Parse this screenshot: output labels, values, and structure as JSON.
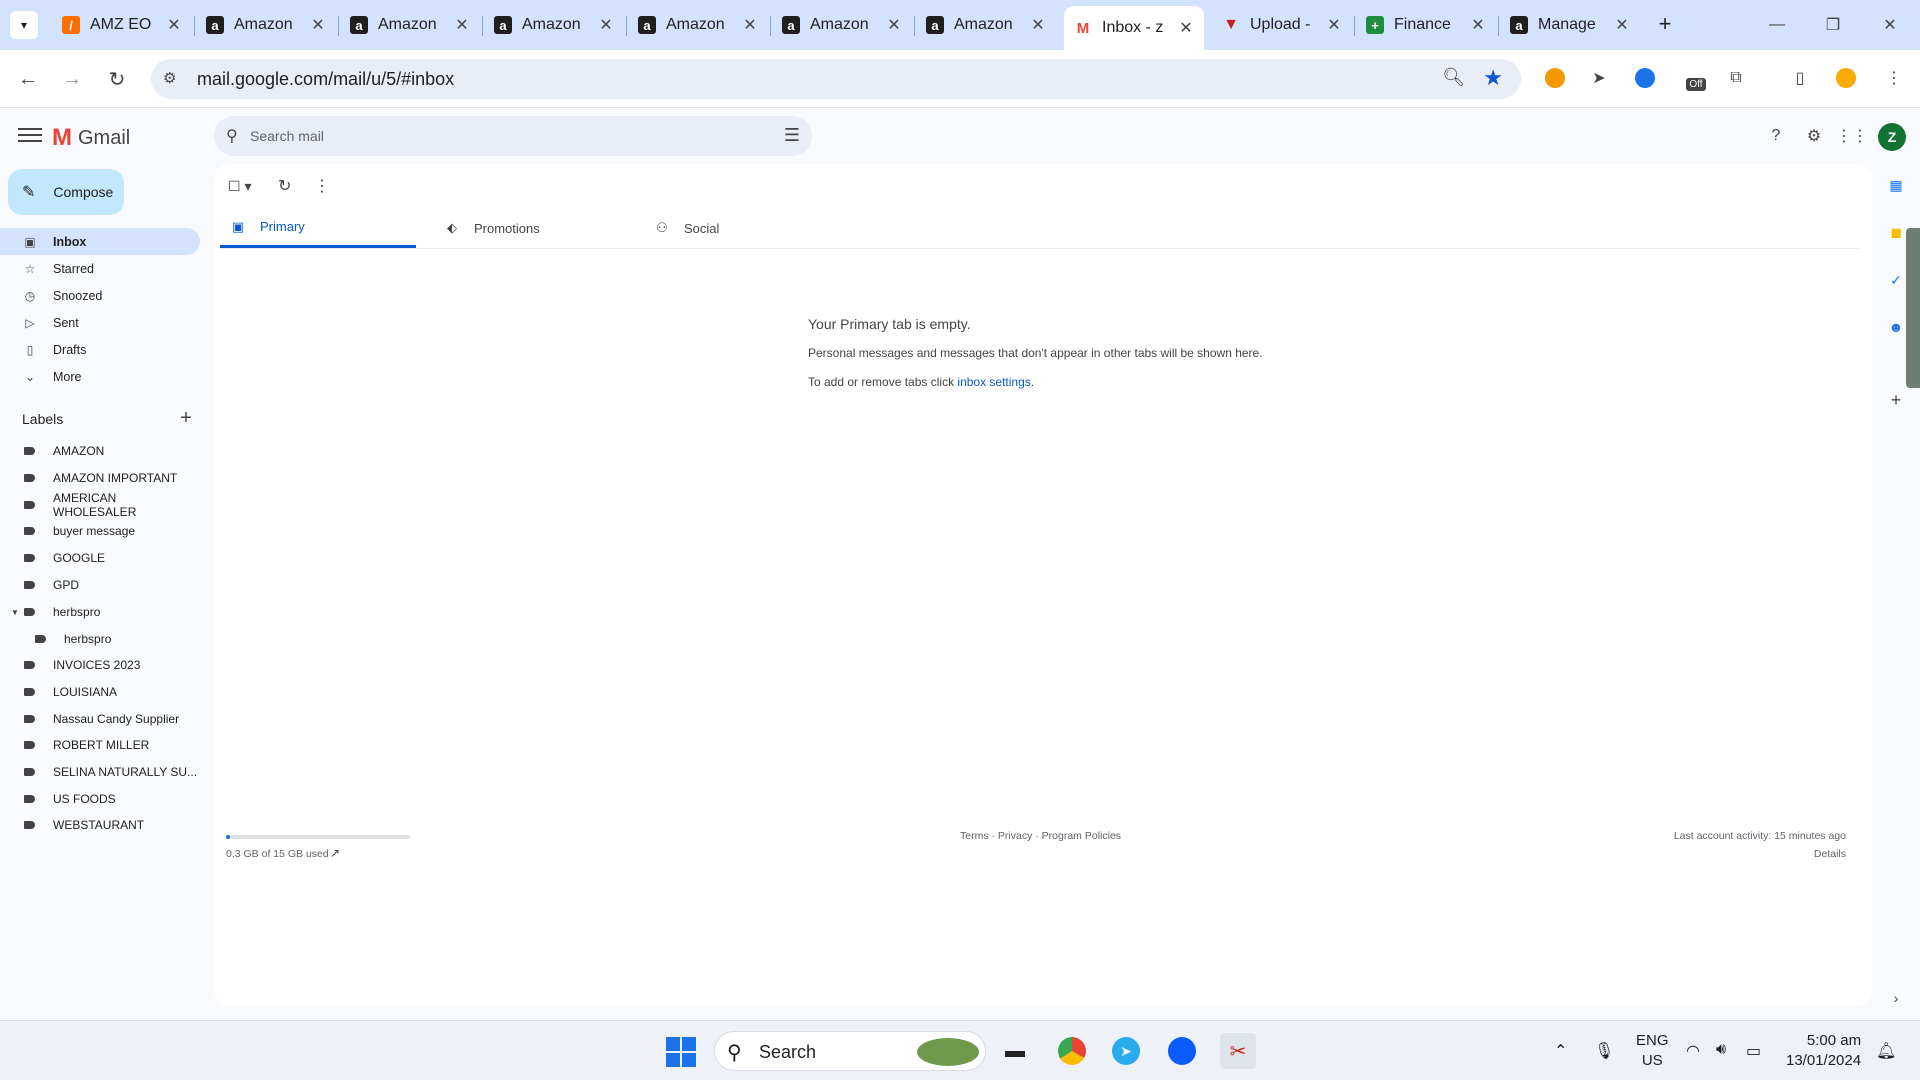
{
  "browser": {
    "tabs": [
      {
        "title": "AMZ EO",
        "favicon": "slash-logo-icon"
      },
      {
        "title": "Amazon",
        "favicon": "amazon-icon"
      },
      {
        "title": "Amazon",
        "favicon": "amazon-icon"
      },
      {
        "title": "Amazon",
        "favicon": "amazon-icon"
      },
      {
        "title": "Amazon",
        "favicon": "amazon-icon"
      },
      {
        "title": "Amazon",
        "favicon": "amazon-icon"
      },
      {
        "title": "Amazon",
        "favicon": "amazon-icon"
      },
      {
        "title": "Inbox - z",
        "favicon": "gmail-icon",
        "active": true
      },
      {
        "title": "Upload -",
        "favicon": "upload-logo-icon"
      },
      {
        "title": "Finance",
        "favicon": "sheets-icon"
      },
      {
        "title": "Manage",
        "favicon": "amazon-icon"
      }
    ],
    "url": "mail.google.com/mail/u/5/#inbox",
    "extension_badge": "Off"
  },
  "gmail": {
    "app_name": "Gmail",
    "search_placeholder": "Search mail",
    "compose_label": "Compose",
    "nav": [
      {
        "label": "Inbox",
        "icon": "inbox-icon",
        "active": true
      },
      {
        "label": "Starred",
        "icon": "star-icon"
      },
      {
        "label": "Snoozed",
        "icon": "clock-icon"
      },
      {
        "label": "Sent",
        "icon": "send-icon"
      },
      {
        "label": "Drafts",
        "icon": "draft-icon"
      },
      {
        "label": "More",
        "icon": "chevron-down-icon"
      }
    ],
    "labels_title": "Labels",
    "labels": [
      "AMAZON",
      "AMAZON IMPORTANT",
      "AMERICAN WHOLESALER",
      "buyer message",
      "GOOGLE",
      "GPD",
      "herbspro",
      "herbspro",
      "INVOICES 2023",
      "LOUISIANA",
      "Nassau Candy Supplier",
      "ROBERT MILLER",
      "SELINA NATURALLY SU...",
      "US FOODS",
      "WEBSTAURANT"
    ],
    "category_tabs": [
      {
        "label": "Primary",
        "icon": "inbox-icon",
        "active": true
      },
      {
        "label": "Promotions",
        "icon": "tag-icon"
      },
      {
        "label": "Social",
        "icon": "people-icon"
      }
    ],
    "empty": {
      "title": "Your Primary tab is empty.",
      "text": "Personal messages and messages that don't appear in other tabs will be shown here.",
      "link_prefix": "To add or remove tabs click ",
      "link_text": "inbox settings",
      "link_suffix": "."
    },
    "storage": {
      "text": "0.3 GB of 15 GB used",
      "used_fraction": 0.02
    },
    "footer_links": "Terms · Privacy · Program Policies",
    "activity": "Last account activity: 15 minutes ago",
    "details_link": "Details"
  },
  "taskbar": {
    "search_label": "Search",
    "lang_top": "ENG",
    "lang_bottom": "US",
    "time": "5:00 am",
    "date": "13/01/2024"
  },
  "colors": {
    "accent": "#0b57d0",
    "compose_bg": "#c2e7ff",
    "active_nav_bg": "#d3e3fd",
    "avatar_bg": "#137333",
    "gmail_red": "#ea4335"
  }
}
